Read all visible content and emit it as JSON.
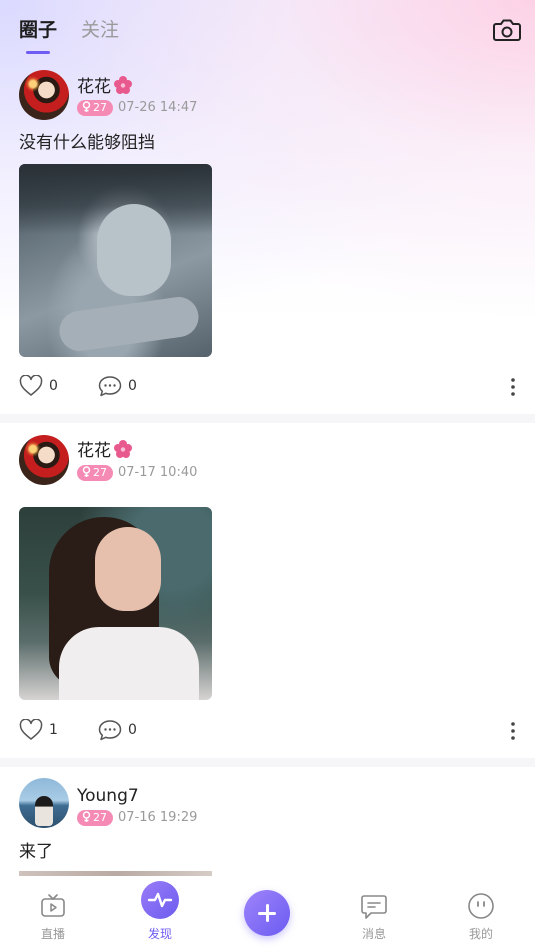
{
  "header": {
    "tabs": [
      {
        "label": "圈子",
        "active": true
      },
      {
        "label": "关注",
        "active": false
      }
    ],
    "camera_icon": "camera-icon",
    "accent_color": "#6e5cf5"
  },
  "posts": [
    {
      "username": "花花",
      "name_emoji": "cherry-blossom-icon",
      "level": "27",
      "gender_icon": "venus-icon",
      "time": "07-26 14:47",
      "text": "没有什么能够阻挡",
      "likes": "0",
      "comments": "0"
    },
    {
      "username": "花花",
      "name_emoji": "cherry-blossom-icon",
      "level": "27",
      "gender_icon": "venus-icon",
      "time": "07-17 10:40",
      "text": "",
      "likes": "1",
      "comments": "0"
    },
    {
      "username": "Young7",
      "level": "27",
      "gender_icon": "venus-icon",
      "time": "07-16 19:29",
      "text": "来了"
    }
  ],
  "tabbar": {
    "items": [
      {
        "label": "直播",
        "icon": "tv-icon"
      },
      {
        "label": "发现",
        "icon": "pulse-icon",
        "active": true
      },
      {
        "label": "",
        "icon": "plus-icon"
      },
      {
        "label": "消息",
        "icon": "message-icon"
      },
      {
        "label": "我的",
        "icon": "face-icon"
      }
    ]
  },
  "colors": {
    "badge_pink": "#f58bb5",
    "tab_active": "#6f5cf4"
  }
}
